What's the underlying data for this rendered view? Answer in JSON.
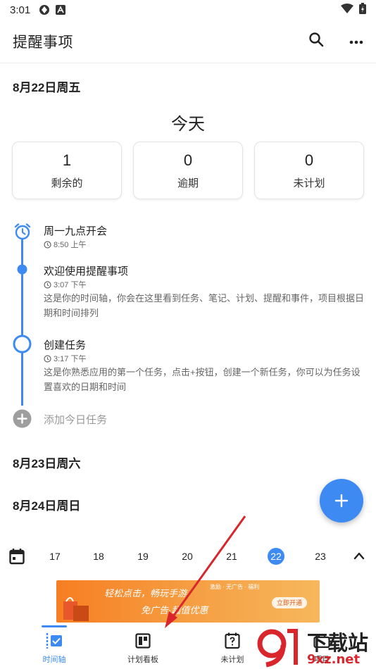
{
  "status_bar": {
    "time": "3:01"
  },
  "app_bar": {
    "title": "提醒事项",
    "search_icon": "search-icon",
    "more_icon": "more-horizontal-icon"
  },
  "today": {
    "date_header": "8月22日周五",
    "label": "今天",
    "stats": [
      {
        "value": "1",
        "label": "剩余的"
      },
      {
        "value": "0",
        "label": "逾期"
      },
      {
        "value": "0",
        "label": "未计划"
      }
    ]
  },
  "timeline": [
    {
      "title": "周一九点开会",
      "time": "8:50 上午",
      "description": "",
      "icon": "alarm-icon"
    },
    {
      "title": "欢迎使用提醒事项",
      "time": "3:07 下午",
      "description": "这是你的时间轴，你会在这里看到任务、笔记、计划、提醒和事件，项目根据日期和时间排列",
      "icon": "dot-icon"
    },
    {
      "title": "创建任务",
      "time": "3:17 下午",
      "description": "这是你熟悉应用的第一个任务，点击+按钮，创建一个新任务，你可以为任务设置喜欢的日期和时间",
      "icon": "ring-icon"
    }
  ],
  "add_task_placeholder": "添加今日任务",
  "date_headers": [
    "8月23日周六",
    "8月24日周日"
  ],
  "week_strip": {
    "days": [
      "17",
      "18",
      "19",
      "20",
      "21",
      "22",
      "23"
    ],
    "selected": "22"
  },
  "ad": {
    "main_text": "轻松点击，畅玩手游",
    "sub_text": "免广告·超值优惠",
    "small_text": "激励 · 无广告 · 福利",
    "button": "立即开通"
  },
  "bottom_nav": [
    {
      "label": "时间轴",
      "icon": "timeline-icon",
      "active": true
    },
    {
      "label": "计划看板",
      "icon": "board-icon",
      "active": false
    },
    {
      "label": "未计划",
      "icon": "unplanned-icon",
      "active": false
    },
    {
      "label": "项目",
      "icon": "briefcase-icon",
      "active": false
    }
  ],
  "watermark": {
    "text1": "下载站",
    "text2": "9xz.net",
    "logo": "9"
  },
  "colors": {
    "accent": "#3d8bf2",
    "ad_orange": "#f77e22",
    "watermark_red": "#d9262c"
  }
}
